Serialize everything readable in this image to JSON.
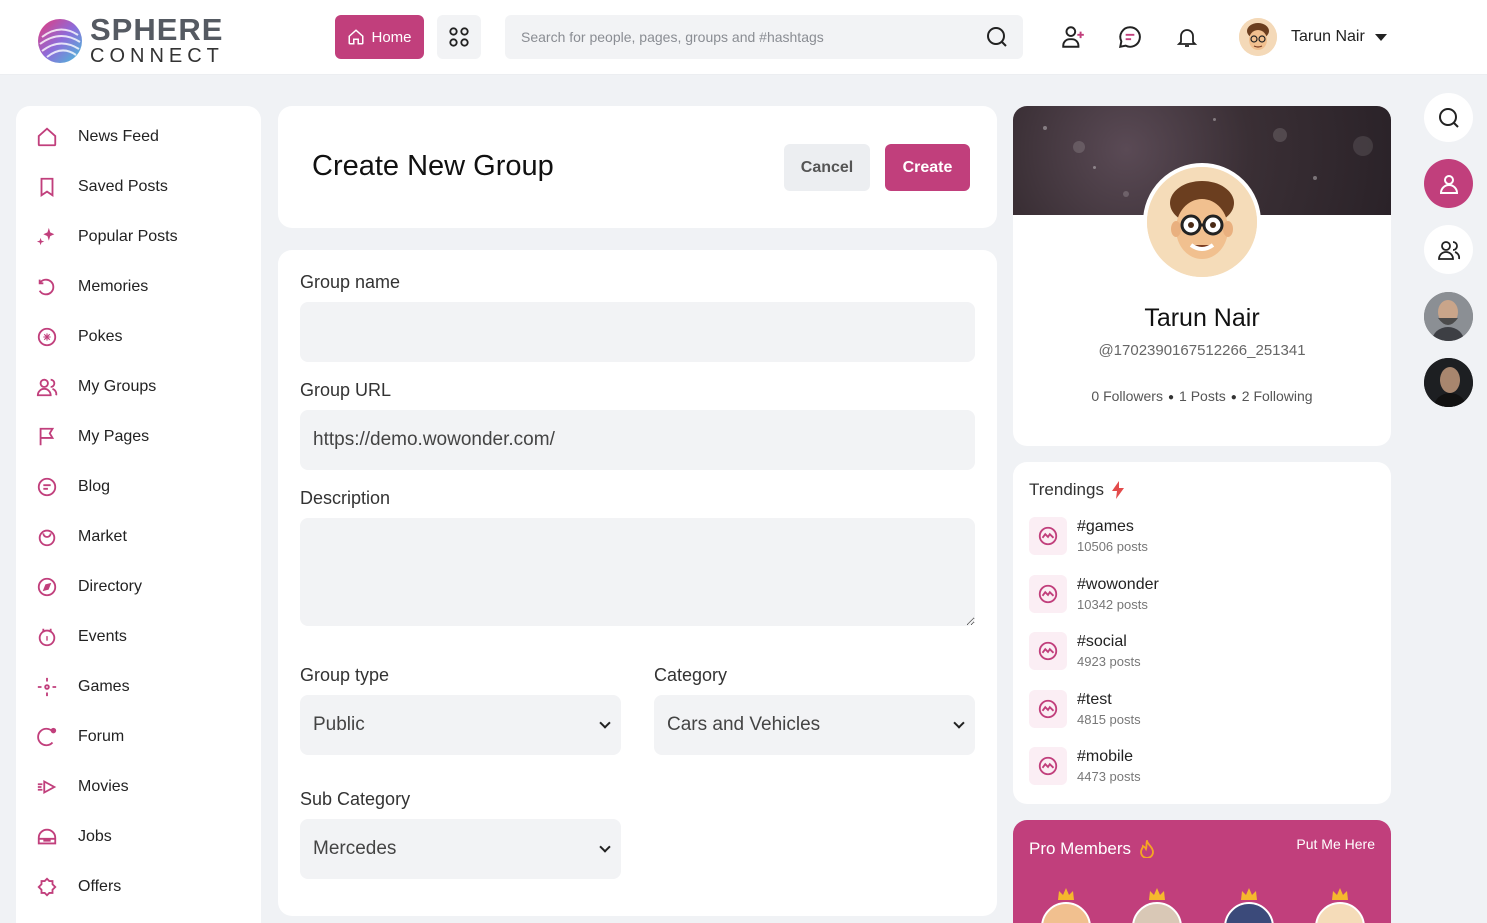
{
  "brand": {
    "name_top": "SPHERE",
    "name_bottom": "CONNECT",
    "accent": "#c13f7c"
  },
  "header": {
    "home_label": "Home",
    "search_placeholder": "Search for people, pages, groups and #hashtags",
    "user_name": "Tarun Nair"
  },
  "sidebar": {
    "items": [
      {
        "label": "News Feed",
        "icon": "home-icon"
      },
      {
        "label": "Saved Posts",
        "icon": "bookmark-icon"
      },
      {
        "label": "Popular Posts",
        "icon": "sparkle-icon"
      },
      {
        "label": "Memories",
        "icon": "memories-icon"
      },
      {
        "label": "Pokes",
        "icon": "poke-icon"
      },
      {
        "label": "My Groups",
        "icon": "groups-icon"
      },
      {
        "label": "My Pages",
        "icon": "flag-icon"
      },
      {
        "label": "Blog",
        "icon": "blog-icon"
      },
      {
        "label": "Market",
        "icon": "market-icon"
      },
      {
        "label": "Directory",
        "icon": "compass-icon"
      },
      {
        "label": "Events",
        "icon": "calendar-icon"
      },
      {
        "label": "Games",
        "icon": "games-icon"
      },
      {
        "label": "Forum",
        "icon": "forum-icon"
      },
      {
        "label": "Movies",
        "icon": "movies-icon"
      },
      {
        "label": "Jobs",
        "icon": "jobs-icon"
      },
      {
        "label": "Offers",
        "icon": "offers-icon"
      }
    ]
  },
  "create_group": {
    "title": "Create New Group",
    "cancel_label": "Cancel",
    "create_label": "Create",
    "fields": {
      "group_name_label": "Group name",
      "group_name_value": "",
      "group_url_label": "Group URL",
      "group_url_value": "https://demo.wowonder.com/",
      "description_label": "Description",
      "description_value": "",
      "group_type_label": "Group type",
      "group_type_value": "Public",
      "category_label": "Category",
      "category_value": "Cars and Vehicles",
      "sub_category_label": "Sub Category",
      "sub_category_value": "Mercedes"
    }
  },
  "profile": {
    "name": "Tarun Nair",
    "handle": "@1702390167512266_251341",
    "followers": "0 Followers",
    "posts": "1 Posts",
    "following": "2 Following"
  },
  "trendings": {
    "title": "Trendings",
    "items": [
      {
        "tag": "#games",
        "count": "10506 posts"
      },
      {
        "tag": "#wowonder",
        "count": "10342 posts"
      },
      {
        "tag": "#social",
        "count": "4923 posts"
      },
      {
        "tag": "#test",
        "count": "4815 posts"
      },
      {
        "tag": "#mobile",
        "count": "4473 posts"
      }
    ]
  },
  "pro_members": {
    "title": "Pro Members",
    "link": "Put Me Here"
  }
}
